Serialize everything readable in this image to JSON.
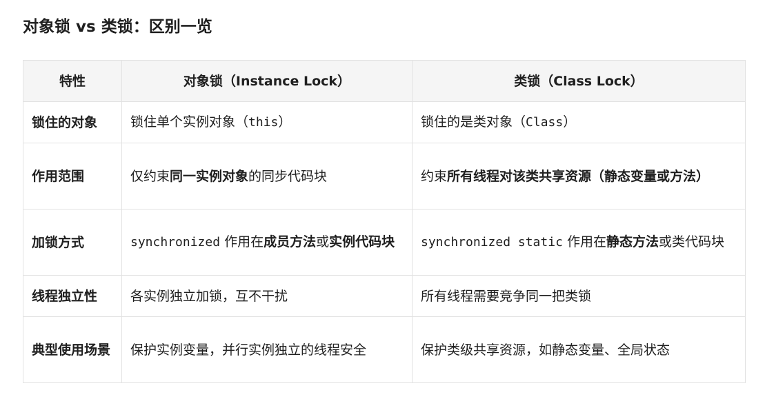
{
  "title": "对象锁 vs 类锁：区别一览",
  "table": {
    "headers": [
      "特性",
      "对象锁（Instance Lock）",
      "类锁（Class Lock）"
    ],
    "rows": [
      {
        "feature": "锁住的对象",
        "instance": {
          "pre": "锁住单个实例对象（",
          "code": "this",
          "post": "）"
        },
        "class": {
          "pre": "锁住的是类对象（",
          "code": "Class",
          "post": "）"
        }
      },
      {
        "feature": "作用范围",
        "instance": {
          "pre": "仅约束",
          "bold": "同一实例对象",
          "post": "的同步代码块"
        },
        "class": {
          "pre": "约束",
          "bold": "所有线程对该类共享资源（静态变量或方法）",
          "post": ""
        }
      },
      {
        "feature": "加锁方式",
        "instance": {
          "code": "synchronized",
          "pre": " 作用在",
          "bold1": "成员方法",
          "mid": "或",
          "bold2": "实例代码块"
        },
        "class": {
          "code": "synchronized static",
          "pre": " 作用在",
          "bold1": "静态方法",
          "mid": "或类代码块"
        }
      },
      {
        "feature": "线程独立性",
        "instance": {
          "text": "各实例独立加锁，互不干扰"
        },
        "class": {
          "text": "所有线程需要竞争同一把类锁"
        }
      },
      {
        "feature": "典型使用场景",
        "instance": {
          "text": "保护实例变量，并行实例独立的线程安全"
        },
        "class": {
          "text": "保护类级共享资源，如静态变量、全局状态"
        }
      }
    ]
  }
}
